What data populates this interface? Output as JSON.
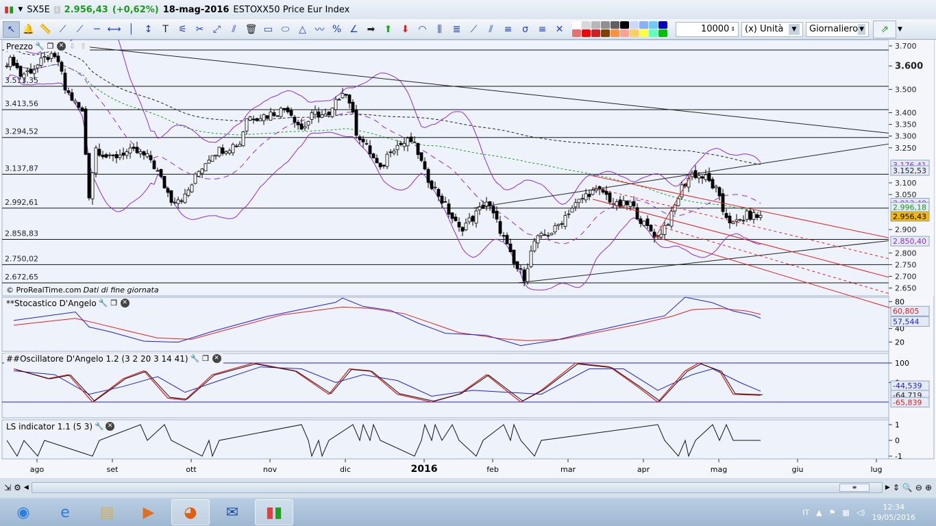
{
  "title_bar": {
    "symbol": "SX5E",
    "last": "2.956,43",
    "change": "(+0,62%)",
    "date": "18-mag-2016",
    "name": "ESTOXX50 Price Eur Index"
  },
  "toolbar": {
    "tools": [
      "pointer-icon",
      "alarm-bell-icon",
      "ruler-icon",
      "segment-icon",
      "line-icon",
      "horizontal-line-icon",
      "horizontal-segment-icon",
      "vertical-line-icon",
      "vertical-segment-icon",
      "text-icon",
      "indicator-icon",
      "tools-icon",
      "ray-icon",
      "parallel-icon",
      "trash-icon",
      "rectangle-icon",
      "ellipse-icon",
      "triangle-icon",
      "trend-icon",
      "percent-icon",
      "angle-icon",
      "arrow-right-icon",
      "arrow-up-icon",
      "arrow-down-icon",
      "fibonacci-arc-icon",
      "fibonacci-time-icon",
      "fibonacci-retracement-icon",
      "fan-icon",
      "channel-icon",
      "raff-icon",
      "pitchfork-icon",
      "sigma-icon",
      "cross-icon"
    ],
    "colors": [
      "#ffffff",
      "#d8d8d8",
      "#b8b8b8",
      "#909090",
      "#606060",
      "#000000",
      "#c8d8ff",
      "#88b0ff",
      "#70c8ff",
      "#0000c0",
      "#e87070",
      "#ff0000",
      "#d02020",
      "#804000",
      "#ff9040",
      "#ffa090",
      "#ffd060",
      "#ffff40",
      "#60ffc0",
      "#00c000"
    ],
    "quantity": "10000",
    "unit": "(x) Unità",
    "period": "Giornaliero"
  },
  "price_panel": {
    "title": "Prezzo",
    "source": "© ProRealTime.com",
    "source_note": "Dati di fine giornata"
  },
  "stoch_panel": {
    "title": "**Stocastico D'Angelo",
    "labels": {
      "red": "60,805",
      "blue": "57,544"
    }
  },
  "osc_panel": {
    "title": "##Oscillatore D'Angelo 1.2 (3 2 20 3 14 41)",
    "labels": {
      "blue": "-44,539",
      "hidden": "-64,719",
      "red": "-65,839"
    }
  },
  "ls_panel": {
    "title": "LS indicator 1.1 (5 3)"
  },
  "price_axis": {
    "ticks": [
      "3.700",
      "3.600",
      "3.500",
      "3.400",
      "3.350",
      "3.300",
      "3.250",
      "3.100",
      "3.050",
      "2.900",
      "2.800",
      "2.750",
      "2.700",
      "2.650"
    ],
    "labels": [
      {
        "text": "3.176,41",
        "color": "#8a2be2"
      },
      {
        "text": "3.152,53",
        "color": "#222222"
      },
      {
        "text": "3.013,40",
        "color": "#8a2be2"
      },
      {
        "text": "2.996,18",
        "color": "#1a9a1a"
      },
      {
        "text": "2.956,43",
        "color": "#000000",
        "bg": "#f5b800"
      },
      {
        "text": "2.850,40",
        "color": "#8a2be2"
      }
    ]
  },
  "levels": [
    {
      "text": "3.513,35",
      "value": 3513
    },
    {
      "text": "3.413,56",
      "value": 3413
    },
    {
      "text": "3.294,52",
      "value": 3294
    },
    {
      "text": "3.137,87",
      "value": 3137
    },
    {
      "text": "2.992,61",
      "value": 2992
    },
    {
      "text": "2.858,83",
      "value": 2858
    },
    {
      "text": "2.750,02",
      "value": 2750
    },
    {
      "text": "2.672,65",
      "value": 2672
    }
  ],
  "stoch_axis": [
    "80",
    "40",
    "20"
  ],
  "osc_axis": [
    "100",
    "0"
  ],
  "ls_axis": [
    "1",
    "0",
    "-1"
  ],
  "time_axis": [
    {
      "label": "ago",
      "day": 7
    },
    {
      "label": "set",
      "day": 29
    },
    {
      "label": "ott",
      "day": 52
    },
    {
      "label": "nov",
      "day": 75
    },
    {
      "label": "dic",
      "day": 97
    },
    {
      "label": "2016",
      "day": 120,
      "bold": true
    },
    {
      "label": "feb",
      "day": 140
    },
    {
      "label": "mar",
      "day": 162
    },
    {
      "label": "apr",
      "day": 184
    },
    {
      "label": "mag",
      "day": 206
    },
    {
      "label": "giu",
      "day": 229
    },
    {
      "label": "lug",
      "day": 252
    }
  ],
  "chart_data": {
    "type": "line",
    "title": "ESTOXX50 Price Eur Index",
    "x_unit": "trading day index",
    "ylim": [
      2650,
      3700
    ],
    "price": [
      [
        2,
        3620
      ],
      [
        4,
        3560
      ],
      [
        8,
        3590
      ],
      [
        12,
        3640
      ],
      [
        15,
        3620
      ],
      [
        17,
        3500
      ],
      [
        22,
        3400
      ],
      [
        24,
        3050
      ],
      [
        26,
        3250
      ],
      [
        30,
        3200
      ],
      [
        34,
        3230
      ],
      [
        38,
        3230
      ],
      [
        42,
        3200
      ],
      [
        48,
        3030
      ],
      [
        52,
        3040
      ],
      [
        56,
        3150
      ],
      [
        60,
        3230
      ],
      [
        68,
        3270
      ],
      [
        70,
        3380
      ],
      [
        76,
        3390
      ],
      [
        82,
        3420
      ],
      [
        86,
        3330
      ],
      [
        90,
        3400
      ],
      [
        94,
        3380
      ],
      [
        98,
        3500
      ],
      [
        100,
        3450
      ],
      [
        102,
        3320
      ],
      [
        106,
        3230
      ],
      [
        109,
        3150
      ],
      [
        112,
        3250
      ],
      [
        118,
        3280
      ],
      [
        120,
        3230
      ],
      [
        122,
        3140
      ],
      [
        126,
        3050
      ],
      [
        132,
        2900
      ],
      [
        136,
        2950
      ],
      [
        140,
        3020
      ],
      [
        144,
        2900
      ],
      [
        148,
        2750
      ],
      [
        151,
        2700
      ],
      [
        154,
        2850
      ],
      [
        160,
        2900
      ],
      [
        164,
        2980
      ],
      [
        170,
        3060
      ],
      [
        174,
        3060
      ],
      [
        178,
        3000
      ],
      [
        182,
        3010
      ],
      [
        186,
        2920
      ],
      [
        190,
        2870
      ],
      [
        194,
        2960
      ],
      [
        197,
        3080
      ],
      [
        200,
        3140
      ],
      [
        204,
        3120
      ],
      [
        207,
        3070
      ],
      [
        209,
        2980
      ],
      [
        212,
        2920
      ],
      [
        216,
        2960
      ],
      [
        220,
        2956
      ]
    ],
    "trendlines": [
      {
        "from": [
          12,
          3700
        ],
        "to": [
          259,
          3310
        ],
        "color": "#222222"
      },
      {
        "from": [
          136,
          2992
        ],
        "to": [
          259,
          3270
        ],
        "color": "#222222"
      },
      {
        "from": [
          149,
          2672
        ],
        "to": [
          259,
          2855
        ],
        "color": "#222222"
      },
      {
        "from": [
          171,
          3130
        ],
        "to": [
          259,
          2860
        ],
        "color": "#e02020"
      },
      {
        "from": [
          171,
          3080
        ],
        "to": [
          259,
          2770
        ],
        "color": "#e02020",
        "dash": true
      },
      {
        "from": [
          171,
          3030
        ],
        "to": [
          259,
          2690
        ],
        "color": "#e02020"
      },
      {
        "from": [
          189,
          2920
        ],
        "to": [
          259,
          2620
        ],
        "color": "#e02020",
        "dash": true
      },
      {
        "from": [
          189,
          2870
        ],
        "to": [
          259,
          2560
        ],
        "color": "#e02020"
      },
      {
        "from": [
          189,
          2860
        ],
        "to": [
          200,
          3140
        ],
        "color": "#e02020"
      }
    ],
    "stoch_blue": [
      [
        2,
        55
      ],
      [
        20,
        62
      ],
      [
        24,
        45
      ],
      [
        30,
        35
      ],
      [
        40,
        22
      ],
      [
        50,
        20
      ],
      [
        60,
        35
      ],
      [
        76,
        60
      ],
      [
        96,
        80
      ],
      [
        98,
        85
      ],
      [
        104,
        70
      ],
      [
        112,
        65
      ],
      [
        120,
        50
      ],
      [
        128,
        30
      ],
      [
        140,
        28
      ],
      [
        150,
        15
      ],
      [
        160,
        20
      ],
      [
        170,
        35
      ],
      [
        180,
        45
      ],
      [
        192,
        60
      ],
      [
        198,
        85
      ],
      [
        206,
        78
      ],
      [
        212,
        65
      ],
      [
        218,
        60
      ],
      [
        220,
        57.5
      ]
    ],
    "stoch_red": [
      [
        2,
        45
      ],
      [
        20,
        55
      ],
      [
        26,
        48
      ],
      [
        34,
        38
      ],
      [
        44,
        26
      ],
      [
        54,
        24
      ],
      [
        64,
        38
      ],
      [
        80,
        60
      ],
      [
        98,
        72
      ],
      [
        106,
        70
      ],
      [
        116,
        62
      ],
      [
        124,
        48
      ],
      [
        132,
        34
      ],
      [
        144,
        25
      ],
      [
        152,
        22
      ],
      [
        162,
        24
      ],
      [
        174,
        36
      ],
      [
        184,
        46
      ],
      [
        194,
        58
      ],
      [
        200,
        68
      ],
      [
        208,
        70
      ],
      [
        216,
        66
      ],
      [
        220,
        61
      ]
    ],
    "osc_red": [
      [
        2,
        70
      ],
      [
        12,
        20
      ],
      [
        18,
        40
      ],
      [
        25,
        -100
      ],
      [
        34,
        20
      ],
      [
        40,
        60
      ],
      [
        47,
        -80
      ],
      [
        52,
        -90
      ],
      [
        60,
        40
      ],
      [
        72,
        100
      ],
      [
        84,
        60
      ],
      [
        94,
        -60
      ],
      [
        100,
        70
      ],
      [
        106,
        60
      ],
      [
        114,
        -60
      ],
      [
        124,
        -100
      ],
      [
        132,
        -60
      ],
      [
        140,
        40
      ],
      [
        150,
        -100
      ],
      [
        156,
        -40
      ],
      [
        166,
        100
      ],
      [
        176,
        80
      ],
      [
        184,
        -20
      ],
      [
        190,
        -100
      ],
      [
        198,
        60
      ],
      [
        202,
        100
      ],
      [
        208,
        60
      ],
      [
        212,
        -60
      ],
      [
        220,
        -65.8
      ]
    ],
    "osc_blue": [
      [
        2,
        60
      ],
      [
        14,
        40
      ],
      [
        24,
        -60
      ],
      [
        34,
        -20
      ],
      [
        44,
        30
      ],
      [
        52,
        -50
      ],
      [
        62,
        10
      ],
      [
        74,
        80
      ],
      [
        86,
        70
      ],
      [
        96,
        0
      ],
      [
        104,
        40
      ],
      [
        114,
        10
      ],
      [
        124,
        -70
      ],
      [
        136,
        -40
      ],
      [
        146,
        -50
      ],
      [
        156,
        -60
      ],
      [
        170,
        70
      ],
      [
        180,
        70
      ],
      [
        190,
        -40
      ],
      [
        200,
        40
      ],
      [
        206,
        70
      ],
      [
        214,
        0
      ],
      [
        220,
        -44.5
      ]
    ],
    "ls": [
      [
        0,
        0
      ],
      [
        3,
        -1
      ],
      [
        5,
        0
      ],
      [
        9,
        -1
      ],
      [
        11,
        0
      ],
      [
        25,
        -1
      ],
      [
        27,
        0
      ],
      [
        39,
        1
      ],
      [
        41,
        0
      ],
      [
        46,
        1
      ],
      [
        48,
        0
      ],
      [
        57,
        -1
      ],
      [
        59,
        0
      ],
      [
        60,
        -1
      ],
      [
        62,
        0
      ],
      [
        86,
        1
      ],
      [
        88,
        0
      ],
      [
        89,
        -1
      ],
      [
        91,
        0
      ],
      [
        92,
        -1
      ],
      [
        94,
        0
      ],
      [
        101,
        1
      ],
      [
        103,
        0
      ],
      [
        104,
        1
      ],
      [
        106,
        0
      ],
      [
        107,
        1
      ],
      [
        109,
        0
      ],
      [
        119,
        -1
      ],
      [
        121,
        0
      ],
      [
        122,
        1
      ],
      [
        124,
        0
      ],
      [
        125,
        1
      ],
      [
        127,
        0
      ],
      [
        130,
        1
      ],
      [
        132,
        0
      ],
      [
        137,
        -1
      ],
      [
        139,
        0
      ],
      [
        145,
        1
      ],
      [
        147,
        0
      ],
      [
        148,
        1
      ],
      [
        150,
        0
      ],
      [
        154,
        -1
      ],
      [
        156,
        0
      ],
      [
        190,
        1
      ],
      [
        192,
        0
      ],
      [
        196,
        -1
      ],
      [
        198,
        0
      ],
      [
        199,
        -1
      ],
      [
        201,
        0
      ],
      [
        206,
        1
      ],
      [
        208,
        0
      ],
      [
        210,
        1
      ],
      [
        212,
        0
      ],
      [
        220,
        0
      ]
    ]
  },
  "taskbar": {
    "apps": [
      "windows-start-icon",
      "internet-explorer-icon",
      "file-explorer-icon",
      "media-player-icon",
      "firefox-icon",
      "thunderbird-icon",
      "prorealtime-icon"
    ],
    "lang": "IT",
    "time": "12:34",
    "date": "19/05/2016"
  }
}
